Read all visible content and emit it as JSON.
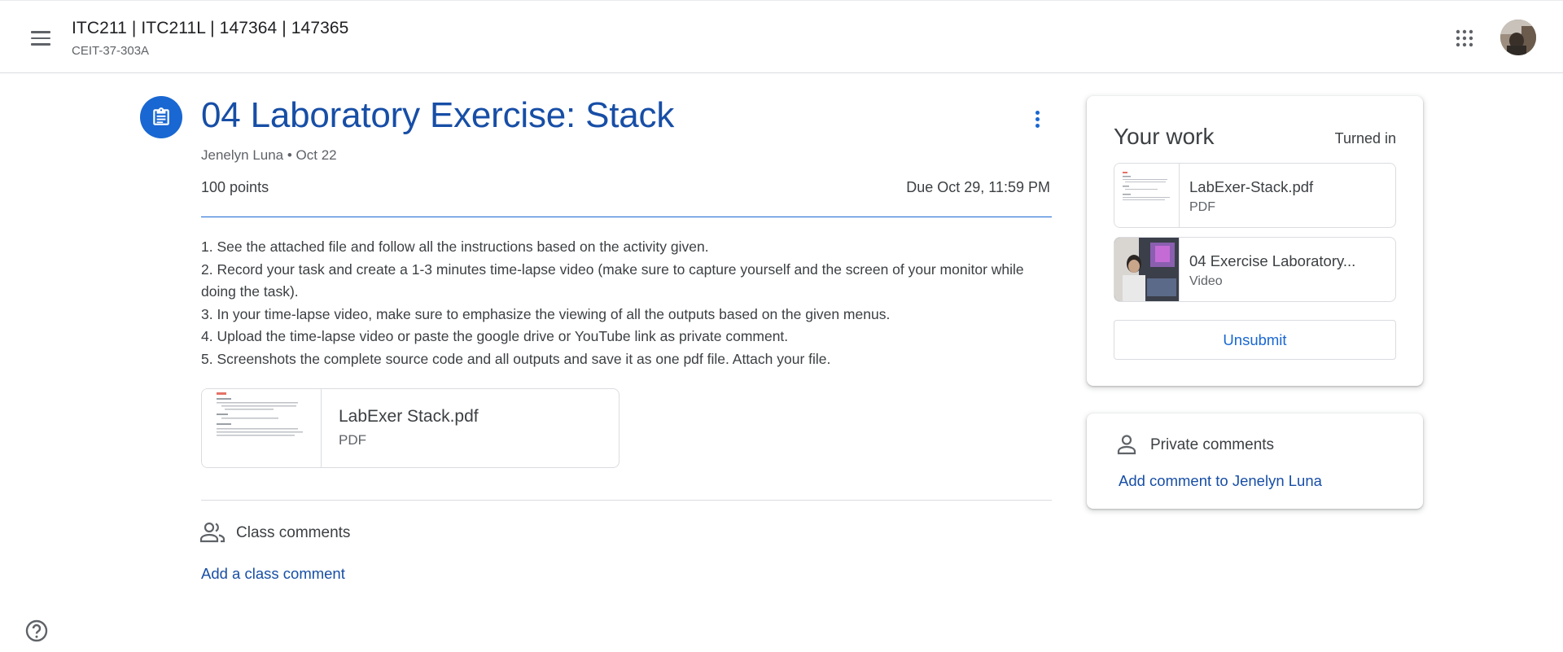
{
  "header": {
    "class_title": "ITC211 | ITC211L | 147364 | 147365",
    "class_section": "CEIT-37-303A",
    "menu_icon": "hamburger-menu-icon",
    "apps_icon": "google-apps-grid-icon",
    "avatar": "user-avatar"
  },
  "assignment": {
    "icon": "assignment-clipboard-icon",
    "title": "04 Laboratory Exercise: Stack",
    "author_date": "Jenelyn Luna • Oct 22",
    "points": "100 points",
    "due": "Due Oct 29, 11:59 PM",
    "instructions": [
      "1. See the attached file and follow all the instructions based on the activity given.",
      "2. Record your task and create a 1-3 minutes time-lapse video (make sure to capture yourself and the screen of your monitor while doing the task).",
      "3. In your time-lapse video, make sure to emphasize the viewing of all the outputs based on the given menus.",
      "4. Upload the time-lapse video or paste the google drive or YouTube link as private comment.",
      "5. Screenshots the complete source code and all outputs and save it as one pdf file. Attach your file."
    ],
    "attachment": {
      "name": "LabExer Stack.pdf",
      "type": "PDF"
    }
  },
  "class_comments": {
    "label": "Class comments",
    "add_link": "Add a class comment"
  },
  "your_work": {
    "title": "Your work",
    "status": "Turned in",
    "items": [
      {
        "name": "LabExer-Stack.pdf",
        "type": "PDF"
      },
      {
        "name": "04 Exercise Laboratory...",
        "type": "Video"
      }
    ],
    "unsubmit_label": "Unsubmit"
  },
  "private_comments": {
    "label": "Private comments",
    "add_link": "Add comment to Jenelyn Luna"
  },
  "colors": {
    "accent": "#1967d2",
    "title_blue": "#174ea6",
    "text": "#3c4043",
    "muted": "#5f6368",
    "border": "#dadce0"
  }
}
